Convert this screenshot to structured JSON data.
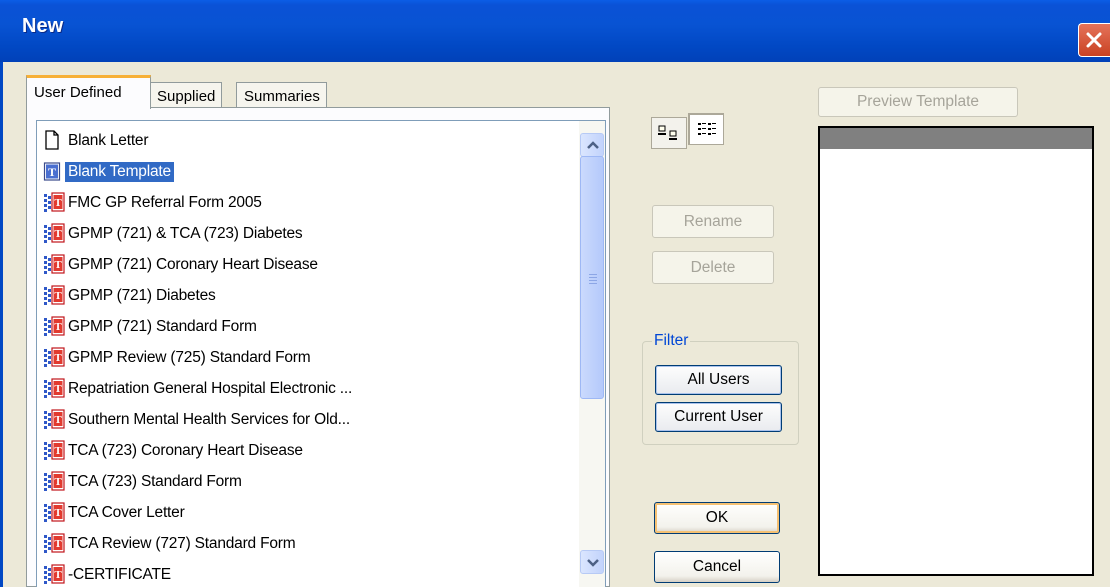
{
  "window": {
    "title": "New"
  },
  "tabs": [
    {
      "label": "User Defined",
      "active": true
    },
    {
      "label": "Supplied",
      "active": false
    },
    {
      "label": "Summaries",
      "active": false
    }
  ],
  "templates": [
    {
      "label": "Blank Letter",
      "icon": "blank-document-icon",
      "selected": false
    },
    {
      "label": "Blank Template",
      "icon": "template-icon",
      "selected": true
    },
    {
      "label": "FMC GP Referral Form 2005",
      "icon": "form-template-icon",
      "selected": false
    },
    {
      "label": "GPMP (721) & TCA (723) Diabetes",
      "icon": "form-template-icon",
      "selected": false
    },
    {
      "label": "GPMP (721) Coronary Heart Disease",
      "icon": "form-template-icon",
      "selected": false
    },
    {
      "label": "GPMP (721) Diabetes",
      "icon": "form-template-icon",
      "selected": false
    },
    {
      "label": "GPMP (721) Standard Form",
      "icon": "form-template-icon",
      "selected": false
    },
    {
      "label": "GPMP Review (725) Standard Form",
      "icon": "form-template-icon",
      "selected": false
    },
    {
      "label": "Repatriation General Hospital Electronic ...",
      "icon": "form-template-icon",
      "selected": false
    },
    {
      "label": "Southern Mental Health Services for Old...",
      "icon": "form-template-icon",
      "selected": false
    },
    {
      "label": "TCA (723) Coronary Heart Disease",
      "icon": "form-template-icon",
      "selected": false
    },
    {
      "label": "TCA (723) Standard Form",
      "icon": "form-template-icon",
      "selected": false
    },
    {
      "label": "TCA Cover Letter",
      "icon": "form-template-icon",
      "selected": false
    },
    {
      "label": "TCA Review (727) Standard Form",
      "icon": "form-template-icon",
      "selected": false
    },
    {
      "label": "-CERTIFICATE",
      "icon": "form-template-icon",
      "selected": false
    }
  ],
  "buttons": {
    "preview_template": "Preview Template",
    "rename": "Rename",
    "delete": "Delete",
    "ok": "OK",
    "cancel": "Cancel"
  },
  "filter": {
    "label": "Filter",
    "all_users": "All Users",
    "current_user": "Current User"
  },
  "colors": {
    "titlebar": "#0148c4",
    "selection": "#316ac5",
    "dialog_face": "#ece9d8",
    "active_tab_accent": "#f7b037",
    "close_button": "#c94223"
  }
}
